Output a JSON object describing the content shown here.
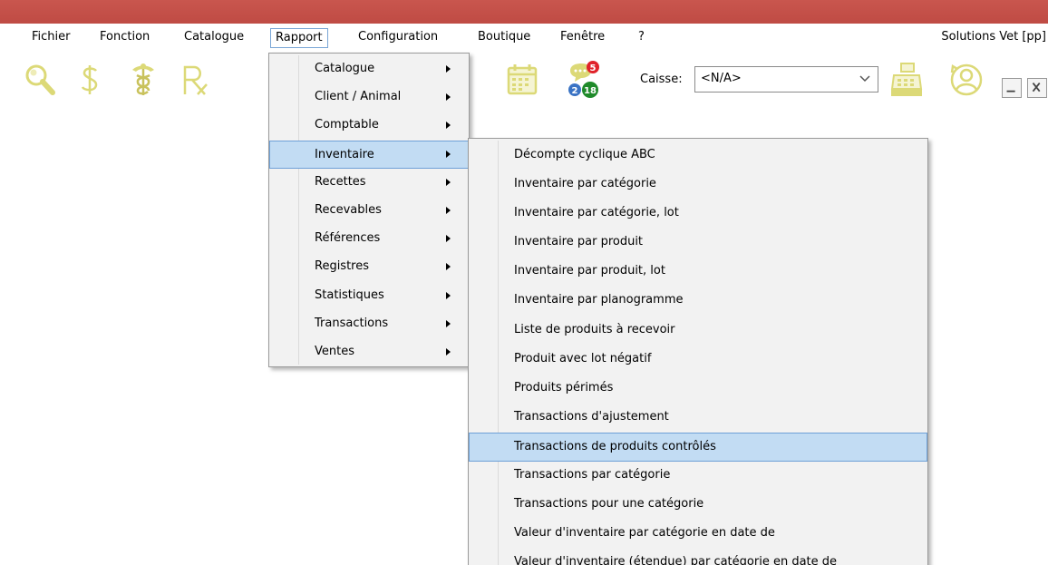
{
  "menubar": {
    "items": [
      "Fichier",
      "Fonction",
      "Catalogue",
      "Rapport",
      "Configuration",
      "Boutique",
      "Fenêtre",
      "?"
    ],
    "app_title": "Solutions Vet [pp]"
  },
  "toolbar": {
    "icons": [
      "search-icon",
      "dollar-icon",
      "caduceus-icon",
      "rx-icon",
      "calendar-icon",
      "messages-icon",
      "cash-register-icon",
      "user-switch-icon"
    ],
    "badges": {
      "red": "5",
      "blue": "2",
      "green": "18"
    },
    "caisse_label": "Caisse:",
    "caisse_value": "<N/A>"
  },
  "rapport_menu": {
    "items": [
      "Catalogue",
      "Client / Animal",
      "Comptable",
      "Inventaire",
      "Recettes",
      "Recevables",
      "Références",
      "Registres",
      "Statistiques",
      "Transactions",
      "Ventes"
    ],
    "highlighted": "Inventaire"
  },
  "inventaire_submenu": {
    "items": [
      "Décompte cyclique ABC",
      "Inventaire par catégorie",
      "Inventaire par catégorie, lot",
      "Inventaire par produit",
      "Inventaire par produit, lot",
      "Inventaire par planogramme",
      "Liste de produits à recevoir",
      "Produit avec lot négatif",
      "Produits périmés",
      "Transactions d'ajustement",
      "Transactions de produits contrôlés",
      "Transactions par catégorie",
      "Transactions pour une catégorie",
      "Valeur d'inventaire par catégorie en date de",
      "Valeur d'inventaire (étendue) par catégorie en date de"
    ],
    "highlighted": "Transactions de produits contrôlés"
  },
  "colors": {
    "title_bar": "#c4504a",
    "icon_yellow": "#dcd977",
    "highlight": "#c2dcf3",
    "highlight_border": "#6ea0d7"
  }
}
